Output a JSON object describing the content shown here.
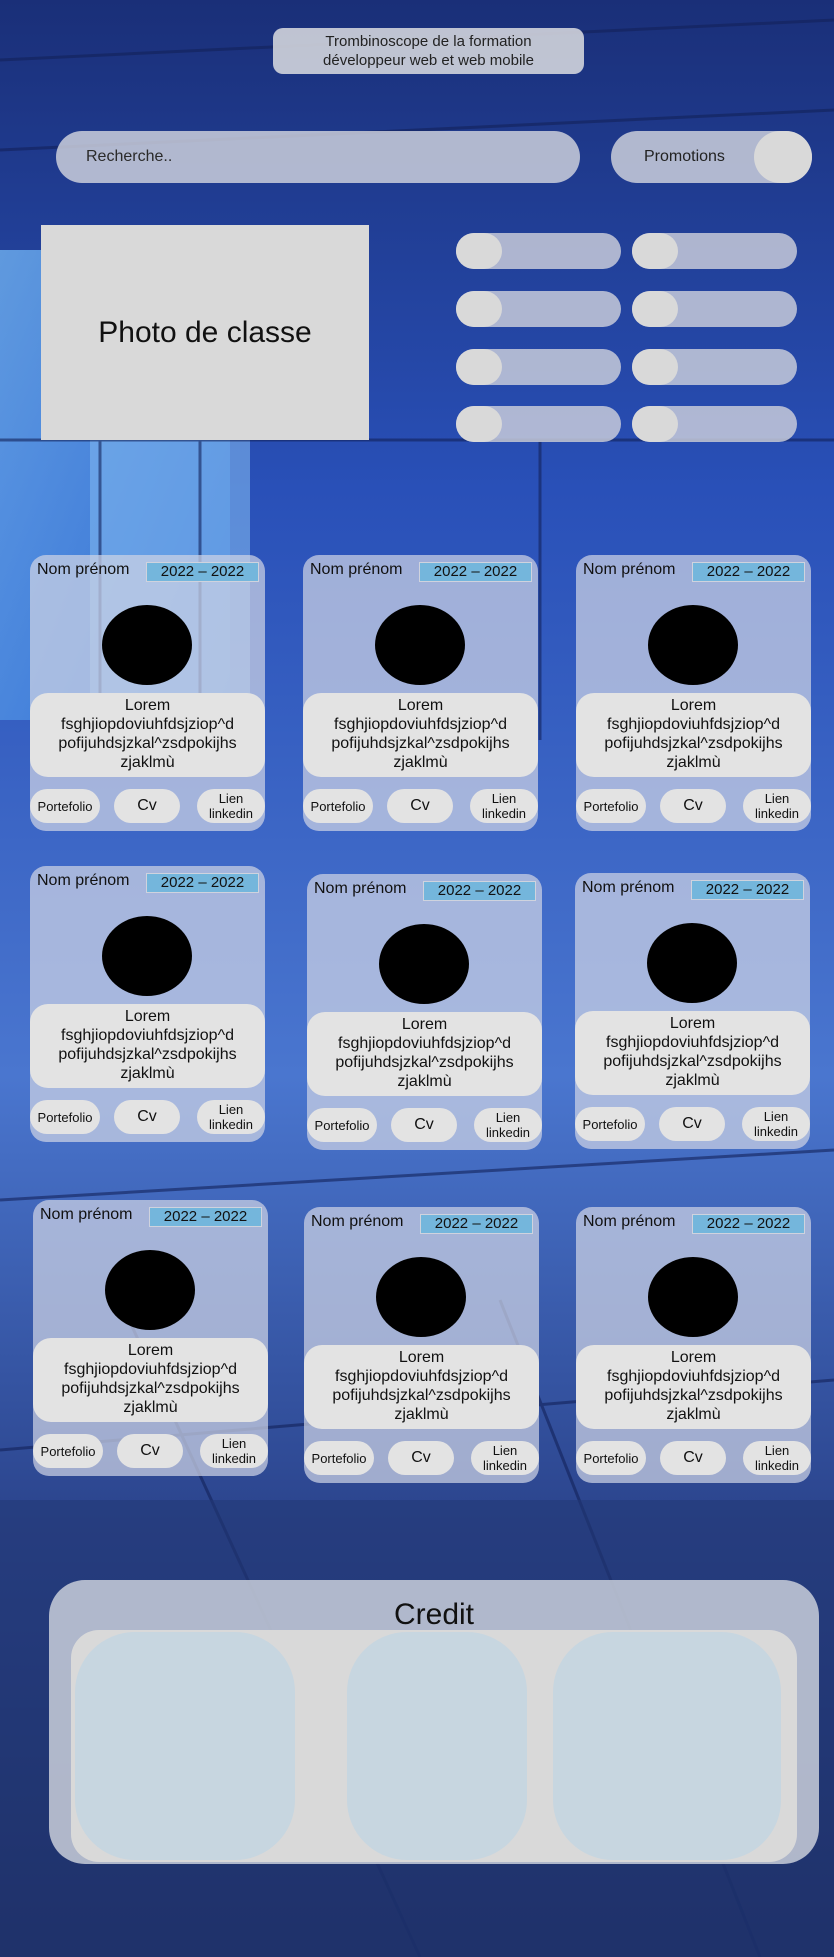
{
  "header": {
    "title_line1": "Trombinoscope de la formation",
    "title_line2": "développeur web et web mobile"
  },
  "search": {
    "placeholder": "Recherche.."
  },
  "promotions": {
    "label": "Promotions"
  },
  "class_photo": {
    "label": "Photo de classe"
  },
  "filter_toggles_count": 8,
  "cards": [
    {
      "name": "Nom prénom",
      "years": "2022 – 2022",
      "desc_line1": "Lorem",
      "desc_line2": "fsghjiopdoviuhfdsjziop^d",
      "desc_line3": "pofijuhdsjzkal^zsdpokijhs",
      "desc_line4": "zjaklmù",
      "portfolio": "Portefolio",
      "cv": "Cv",
      "linkedin_line1": "Lien",
      "linkedin_line2": "linkedin"
    },
    {
      "name": "Nom prénom",
      "years": "2022 – 2022",
      "desc_line1": "Lorem",
      "desc_line2": "fsghjiopdoviuhfdsjziop^d",
      "desc_line3": "pofijuhdsjzkal^zsdpokijhs",
      "desc_line4": "zjaklmù",
      "portfolio": "Portefolio",
      "cv": "Cv",
      "linkedin_line1": "Lien",
      "linkedin_line2": "linkedin"
    },
    {
      "name": "Nom prénom",
      "years": "2022 – 2022",
      "desc_line1": "Lorem",
      "desc_line2": "fsghjiopdoviuhfdsjziop^d",
      "desc_line3": "pofijuhdsjzkal^zsdpokijhs",
      "desc_line4": "zjaklmù",
      "portfolio": "Portefolio",
      "cv": "Cv",
      "linkedin_line1": "Lien",
      "linkedin_line2": "linkedin"
    },
    {
      "name": "Nom prénom",
      "years": "2022 – 2022",
      "desc_line1": "Lorem",
      "desc_line2": "fsghjiopdoviuhfdsjziop^d",
      "desc_line3": "pofijuhdsjzkal^zsdpokijhs",
      "desc_line4": "zjaklmù",
      "portfolio": "Portefolio",
      "cv": "Cv",
      "linkedin_line1": "Lien",
      "linkedin_line2": "linkedin"
    },
    {
      "name": "Nom prénom",
      "years": "2022 – 2022",
      "desc_line1": "Lorem",
      "desc_line2": "fsghjiopdoviuhfdsjziop^d",
      "desc_line3": "pofijuhdsjzkal^zsdpokijhs",
      "desc_line4": "zjaklmù",
      "portfolio": "Portefolio",
      "cv": "Cv",
      "linkedin_line1": "Lien",
      "linkedin_line2": "linkedin"
    },
    {
      "name": "Nom prénom",
      "years": "2022 – 2022",
      "desc_line1": "Lorem",
      "desc_line2": "fsghjiopdoviuhfdsjziop^d",
      "desc_line3": "pofijuhdsjzkal^zsdpokijhs",
      "desc_line4": "zjaklmù",
      "portfolio": "Portefolio",
      "cv": "Cv",
      "linkedin_line1": "Lien",
      "linkedin_line2": "linkedin"
    },
    {
      "name": "Nom prénom",
      "years": "2022 – 2022",
      "desc_line1": "Lorem",
      "desc_line2": "fsghjiopdoviuhfdsjziop^d",
      "desc_line3": "pofijuhdsjzkal^zsdpokijhs",
      "desc_line4": "zjaklmù",
      "portfolio": "Portefolio",
      "cv": "Cv",
      "linkedin_line1": "Lien",
      "linkedin_line2": "linkedin"
    },
    {
      "name": "Nom prénom",
      "years": "2022 – 2022",
      "desc_line1": "Lorem",
      "desc_line2": "fsghjiopdoviuhfdsjziop^d",
      "desc_line3": "pofijuhdsjzkal^zsdpokijhs",
      "desc_line4": "zjaklmù",
      "portfolio": "Portefolio",
      "cv": "Cv",
      "linkedin_line1": "Lien",
      "linkedin_line2": "linkedin"
    },
    {
      "name": "Nom prénom",
      "years": "2022 – 2022",
      "desc_line1": "Lorem",
      "desc_line2": "fsghjiopdoviuhfdsjziop^d",
      "desc_line3": "pofijuhdsjzkal^zsdpokijhs",
      "desc_line4": "zjaklmù",
      "portfolio": "Portefolio",
      "cv": "Cv",
      "linkedin_line1": "Lien",
      "linkedin_line2": "linkedin"
    }
  ],
  "credit": {
    "title": "Credit"
  },
  "colors": {
    "background": "#1f3b8c",
    "year_badge": "#74b6dc",
    "panel": "#d9d9d9"
  }
}
